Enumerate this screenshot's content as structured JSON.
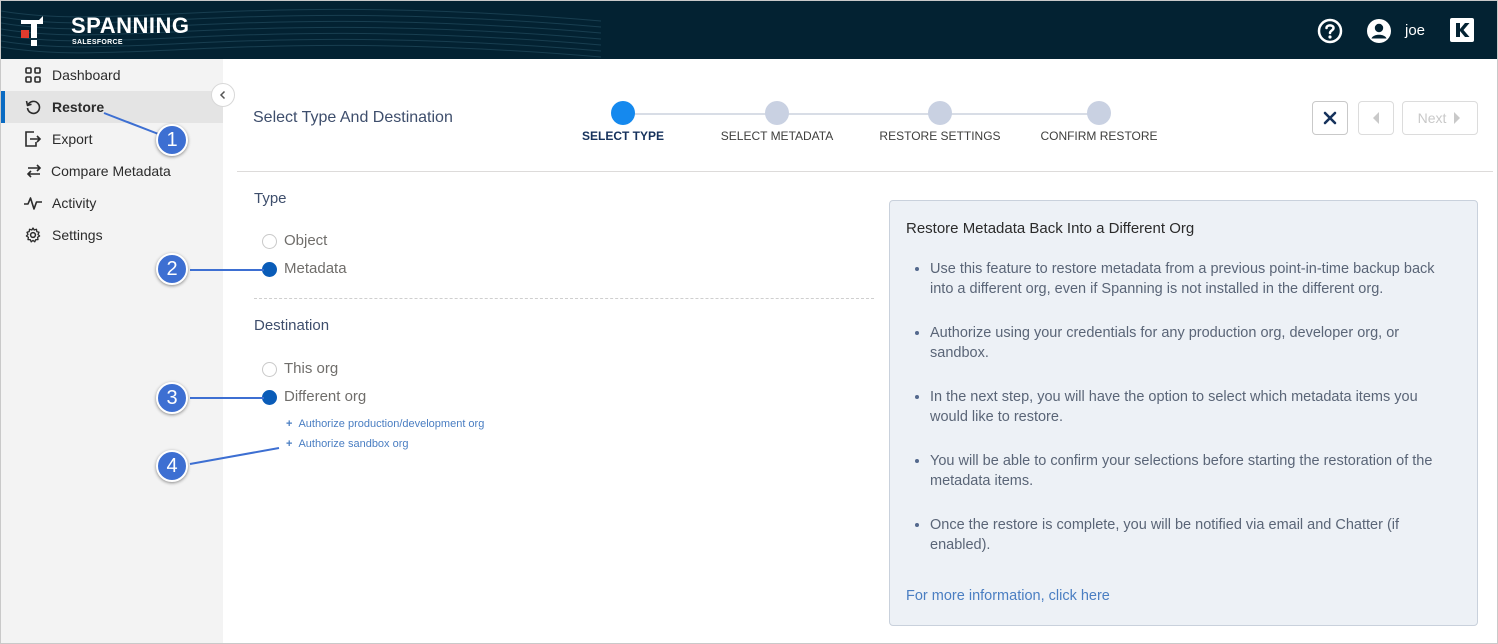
{
  "header": {
    "brand": "SPANNING",
    "brand_sub": "SALESFORCE",
    "username": "joe"
  },
  "sidebar": {
    "items": [
      {
        "label": "Dashboard",
        "icon": "grid-icon"
      },
      {
        "label": "Restore",
        "icon": "restore-icon",
        "active": true
      },
      {
        "label": "Export",
        "icon": "export-icon"
      },
      {
        "label": "Compare Metadata",
        "icon": "compare-arrows-icon"
      },
      {
        "label": "Activity",
        "icon": "activity-icon"
      },
      {
        "label": "Settings",
        "icon": "gear-icon"
      }
    ]
  },
  "wizard": {
    "title": "Select Type And Destination",
    "steps": [
      "SELECT TYPE",
      "SELECT METADATA",
      "RESTORE SETTINGS",
      "CONFIRM RESTORE"
    ],
    "current_step": 0,
    "next_label": "Next"
  },
  "form": {
    "type_label": "Type",
    "type_options": [
      {
        "label": "Object",
        "selected": false
      },
      {
        "label": "Metadata",
        "selected": true
      }
    ],
    "destination_label": "Destination",
    "destination_options": [
      {
        "label": "This org",
        "selected": false
      },
      {
        "label": "Different org",
        "selected": true
      }
    ],
    "auth_links": [
      "Authorize production/development org",
      "Authorize sandbox org"
    ]
  },
  "info": {
    "title": "Restore Metadata Back Into a Different Org",
    "bullets": [
      "Use this feature to restore metadata from a previous point-in-time backup back into a different org, even if Spanning is not installed in the different org.",
      "Authorize using your credentials for any production org, developer org, or sandbox.",
      "In the next step, you will have the option to select which metadata items you would like to restore.",
      "You will be able to confirm your selections before starting the restoration of the metadata items.",
      "Once the restore is complete, you will be notified via email and Chatter (if enabled)."
    ],
    "link": "For more information, click here"
  },
  "callouts": [
    "1",
    "2",
    "3",
    "4"
  ],
  "colors": {
    "header_bg": "#032232",
    "accent": "#1589ee",
    "selected_radio": "#0a5cb8",
    "callout": "#3d6fd2"
  }
}
